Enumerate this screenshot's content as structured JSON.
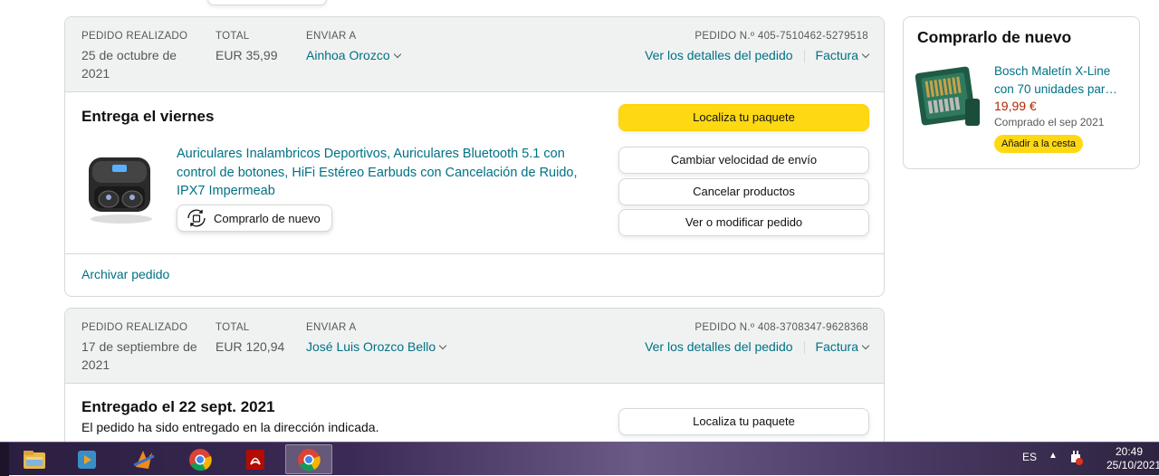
{
  "orders": [
    {
      "placed_label": "PEDIDO REALIZADO",
      "placed_date_line1": "25 de octubre de",
      "placed_date_line2": "2021",
      "total_label": "TOTAL",
      "total_value": "EUR 35,99",
      "ship_to_label": "ENVIAR A",
      "ship_to_name": "Ainhoa Orozco",
      "order_number": "PEDIDO N.º 405-7510462-5279518",
      "details_link": "Ver los detalles del pedido",
      "invoice_link": "Factura",
      "status_title": "Entrega el viernes",
      "product_title": "Auriculares Inalambricos Deportivos, Auriculares Bluetooth 5.1 con control de botones, HiFi Estéreo Earbuds con Cancelación de Ruido, IPX7 Impermeab",
      "buy_again_label": "Comprarlo de nuevo",
      "buttons": {
        "track": "Localiza tu paquete",
        "change_speed": "Cambiar velocidad de envío",
        "cancel": "Cancelar productos",
        "modify": "Ver o modificar pedido"
      },
      "archive_link": "Archivar pedido"
    },
    {
      "placed_label": "PEDIDO REALIZADO",
      "placed_date_line1": "17 de septiembre de",
      "placed_date_line2": "2021",
      "total_label": "TOTAL",
      "total_value": "EUR 120,94",
      "ship_to_label": "ENVIAR A",
      "ship_to_name": "José Luis Orozco Bello",
      "order_number": "PEDIDO N.º 408-3708347-9628368",
      "details_link": "Ver los detalles del pedido",
      "invoice_link": "Factura",
      "status_title": "Entregado el 22 sept. 2021",
      "status_subtitle": "El pedido ha sido entregado en la dirección indicada.",
      "buttons": {
        "track": "Localiza tu paquete"
      }
    }
  ],
  "buy_again_panel": {
    "title": "Comprarlo de nuevo",
    "item_name_line1": "Bosch Maletín X-Line",
    "item_name_line2": "con 70 unidades par…",
    "price": "19,99 €",
    "purchased": "Comprado el sep 2021",
    "add_button": "Añadir a la cesta"
  },
  "taskbar": {
    "apps": [
      "file-explorer-icon",
      "media-player-icon",
      "winamp-icon",
      "chrome-icon",
      "acrobat-icon",
      "chrome-icon"
    ],
    "language": "ES",
    "time": "20:49",
    "date": "25/10/2021"
  },
  "colors": {
    "link": "#007185",
    "primary_button": "#ffd814",
    "header_bg": "#f0f2f2",
    "price": "#b12704"
  }
}
